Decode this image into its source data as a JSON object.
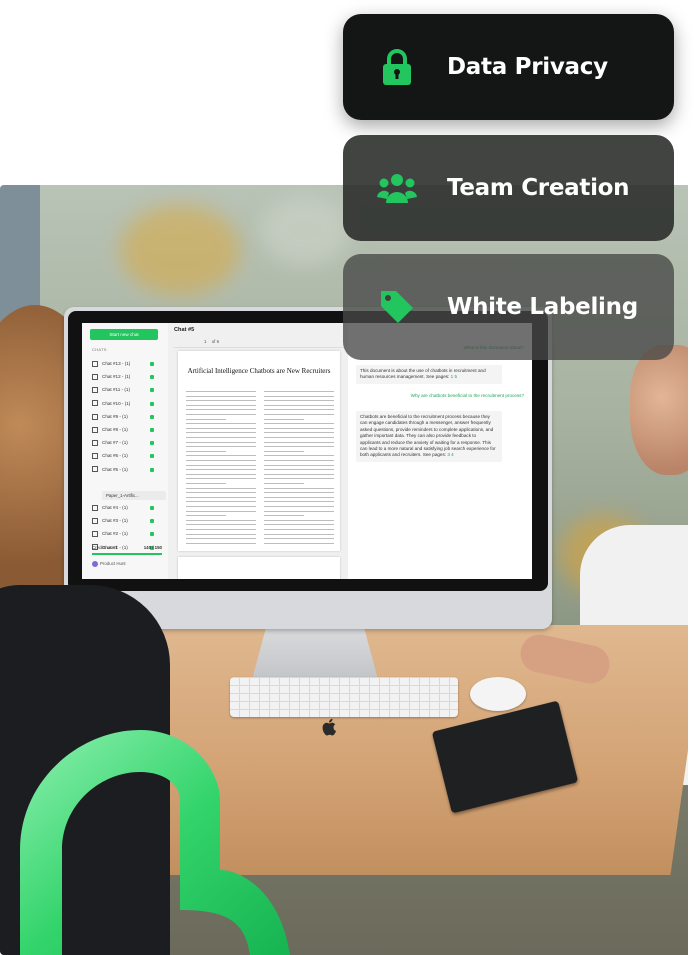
{
  "features": [
    {
      "label": "Data Privacy",
      "icon": "lock-icon"
    },
    {
      "label": "Team Creation",
      "icon": "team-icon"
    },
    {
      "label": "White Labeling",
      "icon": "tag-icon"
    }
  ],
  "colors": {
    "accent": "#22c55e",
    "card_dark": "#141515"
  },
  "app": {
    "new_chat": "Start new chat",
    "chats_label": "CHATS",
    "chats": [
      "Chat #13 - (1)",
      "Chat #12 - (1)",
      "Chat #11 - (1)",
      "Chat #10 - (1)",
      "Chat #9 - (1)",
      "Chat #8 - (1)",
      "Chat #7 - (1)",
      "Chat #6 - (1)",
      "Chat #5 - (1)"
    ],
    "paper_item": "Paper_1-Artific...",
    "chats_after": [
      "Chat #4 - (1)",
      "Chat #3 - (1)",
      "Chat #2 - (1)",
      "Chat #1 - (1)"
    ],
    "credits_label": "Credits used:",
    "credits_value": "140 / 150",
    "product_hunt": "Product Hunt",
    "doc_title": "Chat #5",
    "page_num": "1",
    "page_total": "of 6",
    "paper_title": "Artificial Intelligence Chatbots are New Recruiters",
    "question_1": "What is this document about?",
    "answer_1": "This document is about the use of chatbots in recruitment and human resources management. See pages:",
    "answer_1_src": "1 5",
    "question_2": "Why are chatbots beneficial to the recruitment process?",
    "answer_2": "Chatbots are beneficial to the recruitment process because they can engage candidates through a messenger, answer frequently asked questions, provide reminders to complete applications, and gather important data. They can also provide feedback to applicants and reduce the anxiety of waiting for a response. This can lead to a more natural and satisfying job search experience for both applicants and recruiters. See pages:",
    "answer_2_src": "3 4"
  }
}
